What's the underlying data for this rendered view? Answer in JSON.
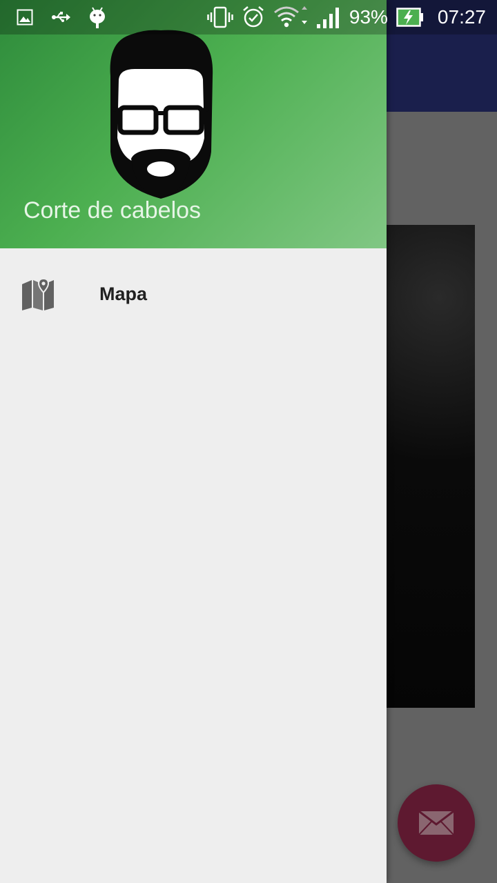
{
  "status_bar": {
    "icons_left": [
      "image-icon",
      "usb-icon",
      "android-debug-icon"
    ],
    "icons_right": [
      "vibrate-icon",
      "alarm-icon",
      "wifi-icon",
      "signal-icon",
      "battery-charging-icon"
    ],
    "battery_percent": "93%",
    "time": "07:27"
  },
  "drawer": {
    "header": {
      "title": "Corte de cabelos",
      "avatar_icon": "bearded-man-avatar"
    },
    "menu_items": [
      {
        "label": "Mapa",
        "icon": "map-icon"
      }
    ]
  },
  "fab": {
    "icon": "email-icon"
  },
  "colors": {
    "drawer_header_start": "#2e8b3b",
    "drawer_header_end": "#81c784",
    "toolbar_dim": "#1a1f4c",
    "fab": "#5e1930",
    "drawer_bg": "#eeeeee"
  }
}
